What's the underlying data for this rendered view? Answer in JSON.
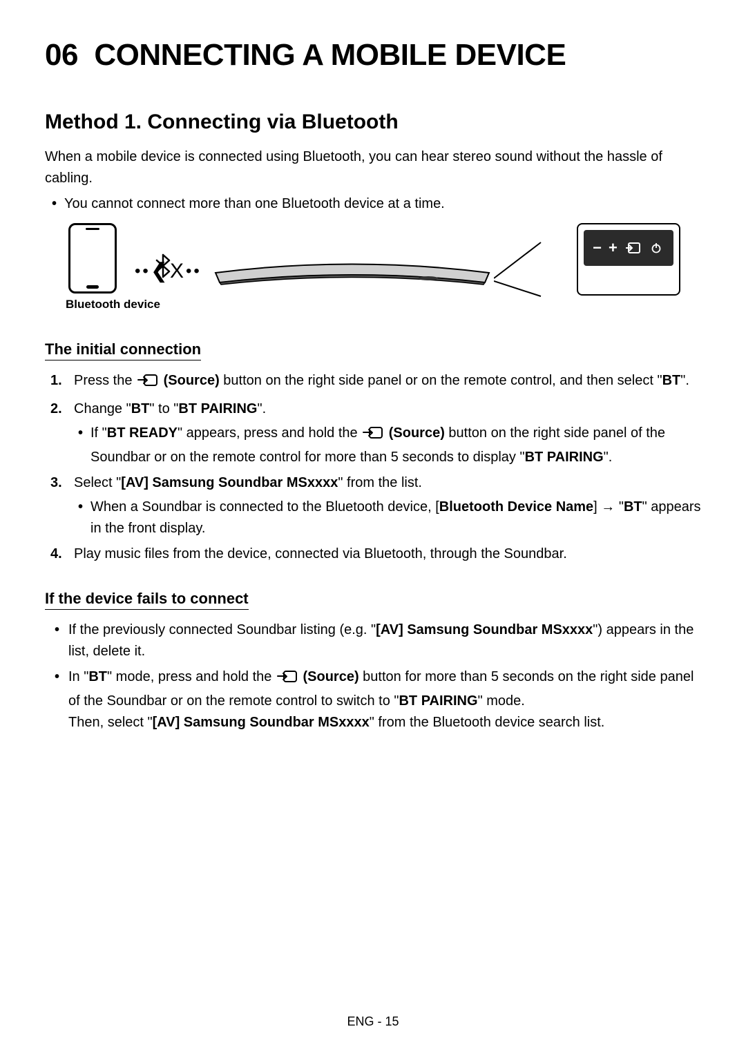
{
  "chapter": {
    "number": "06",
    "title": "CONNECTING A MOBILE DEVICE"
  },
  "section": {
    "title": "Method 1. Connecting via Bluetooth",
    "intro": "When a mobile device is connected using Bluetooth, you can hear stereo sound without the hassle of cabling.",
    "top_bullet": "You cannot connect more than one Bluetooth device at a time."
  },
  "illustration": {
    "caption": "Bluetooth device"
  },
  "sub1": {
    "heading": "The initial connection",
    "steps": {
      "s1_a": "Press the ",
      "s1_b": " (Source)",
      "s1_c": " button on the right side panel or on the remote control, and then select \"",
      "s1_d": "BT",
      "s1_e": "\".",
      "s2_a": "Change \"",
      "s2_b": "BT",
      "s2_c": "\" to \"",
      "s2_d": "BT PAIRING",
      "s2_e": "\".",
      "s2_sub_a": "If \"",
      "s2_sub_b": "BT READY",
      "s2_sub_c": "\" appears, press and hold the ",
      "s2_sub_d": " (Source)",
      "s2_sub_e": " button on the right side panel of the Soundbar or on the remote control for more than 5 seconds to display \"",
      "s2_sub_f": "BT PAIRING",
      "s2_sub_g": "\".",
      "s3_a": "Select \"",
      "s3_b": "[AV] Samsung Soundbar MSxxxx",
      "s3_c": "\" from the list.",
      "s3_sub_a": "When a Soundbar is connected to the Bluetooth device, [",
      "s3_sub_b": "Bluetooth Device Name",
      "s3_sub_c": "] → \"",
      "s3_sub_d": "BT",
      "s3_sub_e": "\" appears in the front display.",
      "s4": "Play music files from the device, connected via Bluetooth, through the Soundbar."
    }
  },
  "sub2": {
    "heading": "If the device fails to connect",
    "b1_a": "If the previously connected Soundbar listing (e.g. \"",
    "b1_b": "[AV] Samsung Soundbar MSxxxx",
    "b1_c": "\") appears in the list, delete it.",
    "b2_a": "In \"",
    "b2_b": "BT",
    "b2_c": "\" mode, press and hold the ",
    "b2_d": " (Source)",
    "b2_e": " button for more than 5 seconds on the right side panel of the Soundbar or on the remote control to switch to \"",
    "b2_f": "BT PAIRING",
    "b2_g": "\" mode.",
    "b2_h": "Then, select \"",
    "b2_i": "[AV] Samsung Soundbar MSxxxx",
    "b2_j": "\" from the Bluetooth device search list."
  },
  "footer": {
    "text": "ENG - 15"
  },
  "icons": {
    "source": "source-icon",
    "bluetooth": "bluetooth-icon",
    "minus": "−",
    "plus": "+",
    "power": "⏻"
  }
}
